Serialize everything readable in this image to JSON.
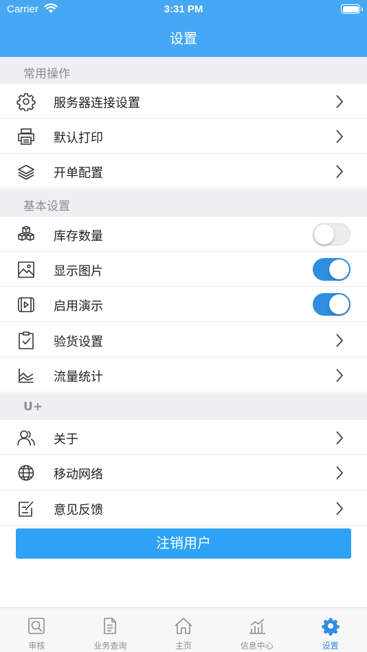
{
  "status_bar": {
    "carrier": "Carrier",
    "time": "3:31 PM"
  },
  "nav": {
    "title": "设置"
  },
  "sections": [
    {
      "title": "常用操作"
    },
    {
      "title": "基本设置"
    },
    {
      "title": "U+"
    }
  ],
  "common_ops": [
    {
      "label": "服务器连接设置",
      "icon": "gear-icon"
    },
    {
      "label": "默认打印",
      "icon": "printer-icon"
    },
    {
      "label": "开单配置",
      "icon": "layers-icon"
    }
  ],
  "basic_settings": [
    {
      "label": "库存数量",
      "icon": "boxes-icon",
      "toggle": false
    },
    {
      "label": "显示图片",
      "icon": "image-icon",
      "toggle": true
    },
    {
      "label": "启用演示",
      "icon": "video-icon",
      "toggle": true
    },
    {
      "label": "验货设置",
      "icon": "clipboard-check-icon"
    },
    {
      "label": "流量统计",
      "icon": "line-chart-icon"
    }
  ],
  "uplus": [
    {
      "label": "关于",
      "icon": "users-icon"
    },
    {
      "label": "移动网络",
      "icon": "globe-icon"
    },
    {
      "label": "意见反馈",
      "icon": "feedback-icon"
    }
  ],
  "logout_button": "注销用户",
  "tabs": [
    {
      "label": "审核",
      "icon": "audit-icon"
    },
    {
      "label": "业务查询",
      "icon": "document-icon"
    },
    {
      "label": "主页",
      "icon": "home-icon"
    },
    {
      "label": "信息中心",
      "icon": "bar-chart-icon"
    },
    {
      "label": "设置",
      "icon": "gear-icon",
      "active": true
    }
  ],
  "colors": {
    "primary": "#46a8f4",
    "button": "#2ea3f5",
    "toggle_on": "#2f8ee0",
    "section_bg": "#eef0f4"
  }
}
